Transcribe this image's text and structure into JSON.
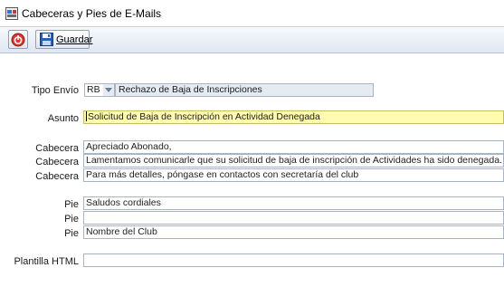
{
  "window": {
    "title": "Cabeceras y Pies de E-Mails",
    "icon": "app-window-icon"
  },
  "toolbar": {
    "exit_icon": "power-icon",
    "save_icon": "floppy-disk-icon",
    "save_label": "Guardar"
  },
  "form": {
    "tipo_envio": {
      "label": "Tipo Envío",
      "code": "RB",
      "description": "Rechazo de Baja de Inscripciones"
    },
    "asunto": {
      "label": "Asunto",
      "value": "Solicitud de Baja de Inscripción en Actividad Denegada"
    },
    "cabeceras": [
      {
        "label": "Cabecera",
        "value": "Apreciado Abonado,"
      },
      {
        "label": "Cabecera",
        "value": "Lamentamos comunicarle que su solicitud de baja de inscripción de Actividades ha sido denegada."
      },
      {
        "label": "Cabecera",
        "value": "Para más detalles, póngase en contactos con secretaría del club"
      }
    ],
    "pies": [
      {
        "label": "Pie",
        "value": "Saludos cordiales"
      },
      {
        "label": "Pie",
        "value": ""
      },
      {
        "label": "Pie",
        "value": "Nombre del Club"
      }
    ],
    "plantilla_html": {
      "label": "Plantilla HTML",
      "value": ""
    }
  },
  "colors": {
    "highlight_field": "#fffbb0",
    "toolbar_gradient_end": "#dfe7f3"
  }
}
